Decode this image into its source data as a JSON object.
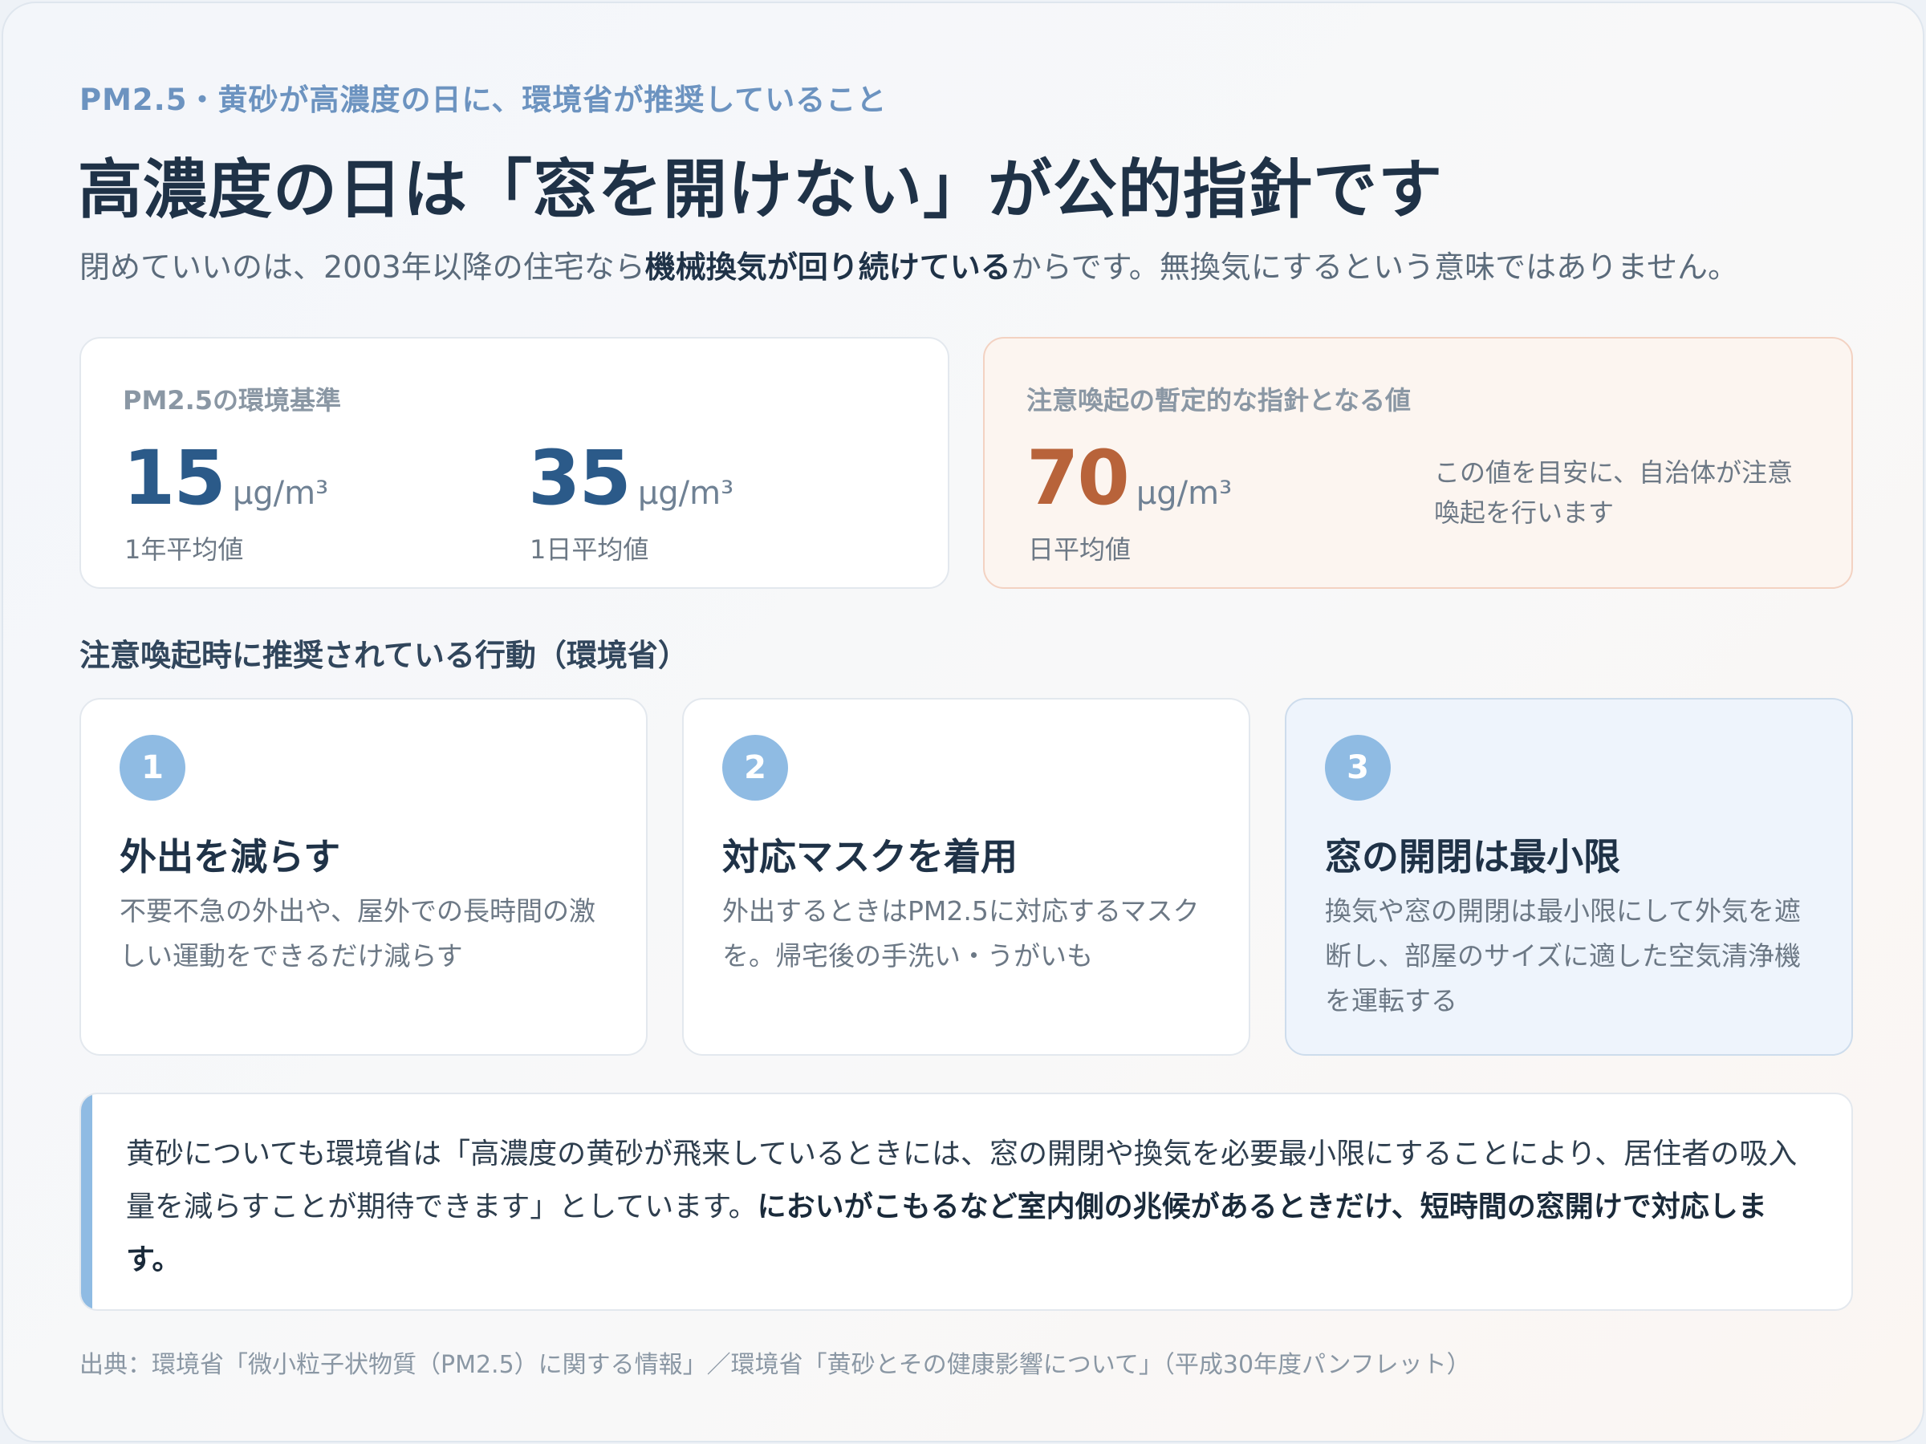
{
  "header": {
    "eyebrow": "PM2.5・黄砂が高濃度の日に、環境省が推奨していること",
    "title": "高濃度の日は「窓を開けない」が公的指針です",
    "lead_before": "閉めていいのは、2003年以降の住宅なら",
    "lead_bold": "機械換気が回り続けている",
    "lead_after": "からです。無換気にするという意味ではありません。"
  },
  "standard": {
    "label": "PM2.5の環境基準",
    "annual": {
      "value": "15",
      "unit": "μg/m³",
      "caption": "1年平均値"
    },
    "daily": {
      "value": "35",
      "unit": "μg/m³",
      "caption": "1日平均値"
    }
  },
  "alert": {
    "label": "注意喚起の暫定的な指針となる値",
    "value": "70",
    "unit": "μg/m³",
    "caption": "日平均値",
    "note": "この値を目安に、自治体が注意喚起を行います"
  },
  "actions": {
    "section_title": "注意喚起時に推奨されている行動（環境省）",
    "items": [
      {
        "number": "1",
        "title": "外出を減らす",
        "text": "不要不急の外出や、屋外での長時間の激しい運動をできるだけ減らす"
      },
      {
        "number": "2",
        "title": "対応マスクを着用",
        "text": "外出するときはPM2.5に対応するマスクを。帰宅後の手洗い・うがいも"
      },
      {
        "number": "3",
        "title": "窓の開閉は最小限",
        "text": "換気や窓の開閉は最小限にして外気を遮断し、部屋のサイズに適した空気清浄機を運転する"
      }
    ]
  },
  "callout": {
    "text": "黄砂についても環境省は「高濃度の黄砂が飛来しているときには、窓の開閉や換気を必要最小限にすることにより、居住者の吸入量を減らすことが期待できます」としています。",
    "bold": "においがこもるなど室内側の兆候があるときだけ、短時間の窓開けで対応します。"
  },
  "source": "出典：環境省「微小粒子状物質（PM2.5）に関する情報」／環境省「黄砂とその健康影響について」（平成30年度パンフレット）",
  "colors": {
    "accent_blue": "#2b5a89",
    "accent_orange": "#b8633a",
    "badge_blue": "#8fbbe3"
  }
}
